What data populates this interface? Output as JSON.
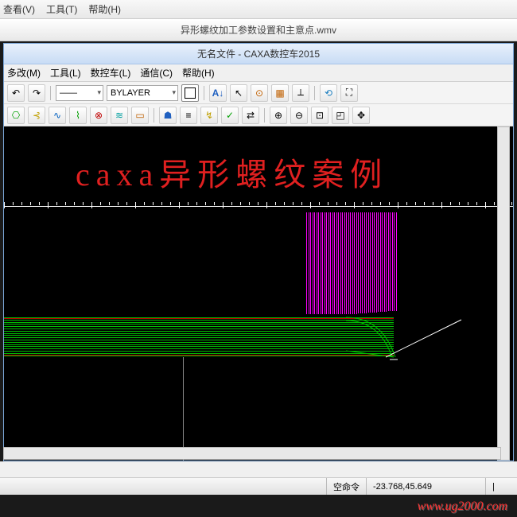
{
  "outer": {
    "title": "异形螺纹加工参数设置和主意点.wmv",
    "menu": {
      "view": "查看(V)",
      "tool": "工具(T)",
      "help": "帮助(H)"
    }
  },
  "inner": {
    "title": "无名文件 - CAXA数控车2015",
    "menu": {
      "modify": "多改(M)",
      "tool": "工具(L)",
      "lathe": "数控车(L)",
      "comm": "通信(C)",
      "help": "帮助(H)"
    }
  },
  "toolbar": {
    "layer_dropdown": "BYLAYER",
    "linetype_dropdown": "——"
  },
  "canvas": {
    "overlay_text": "caxa异形螺纹案例"
  },
  "status": {
    "cmd_label": "空命令",
    "coords": "-23.768,45.649",
    "blank": "|"
  },
  "watermark": "www.ug2000.com"
}
